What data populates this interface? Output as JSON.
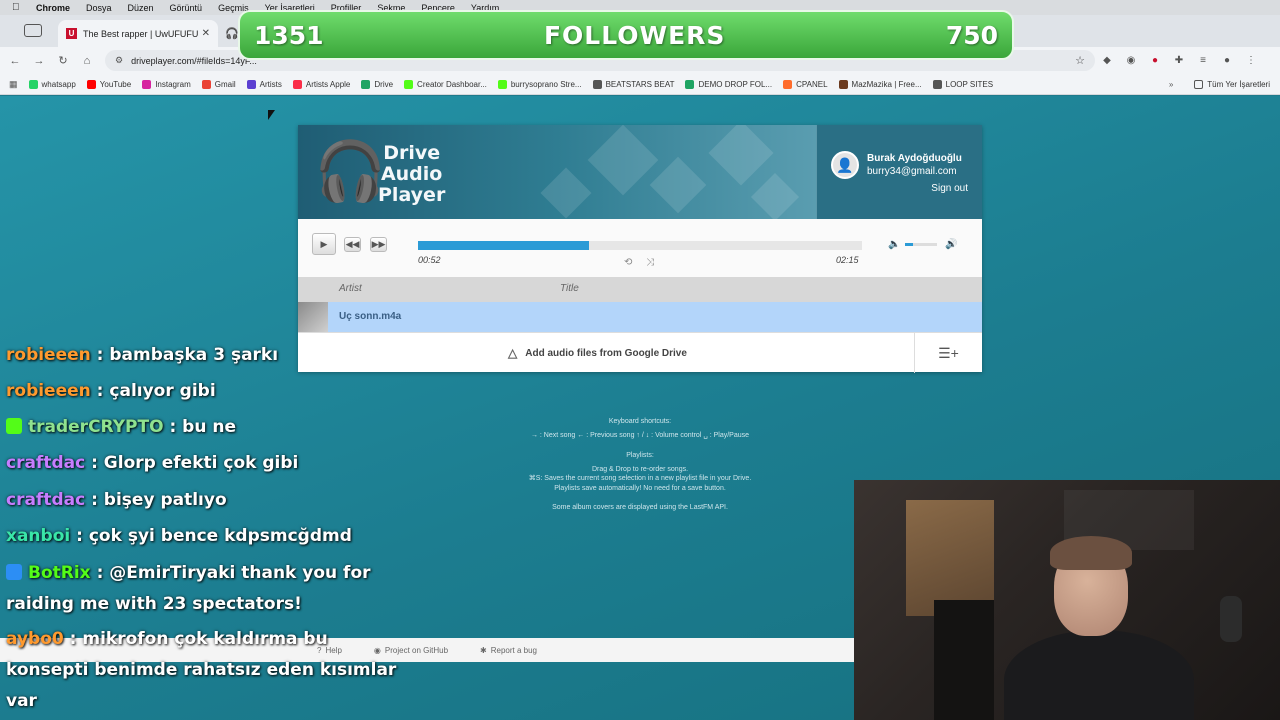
{
  "menubar": {
    "apple": "",
    "items": [
      "Chrome",
      "Dosya",
      "Düzen",
      "Görüntü",
      "Geçmiş",
      "Yer İşaretleri",
      "Profiller",
      "Sekme",
      "Pencere",
      "Yardım"
    ]
  },
  "tabs": {
    "active_title": "The Best rapper | UwUFUFU",
    "active_favicon": "U",
    "second_icon": "headphones-icon"
  },
  "toolbar": {
    "url": "driveplayer.com/#fileIds=14yF..."
  },
  "bookmarks": [
    {
      "label": "whatsapp",
      "color": "#25d366"
    },
    {
      "label": "YouTube",
      "color": "#ff0000"
    },
    {
      "label": "Instagram",
      "color": "#d6249f"
    },
    {
      "label": "Gmail",
      "color": "#ea4335"
    },
    {
      "label": "Artists",
      "color": "#5b3fd1"
    },
    {
      "label": "Artists Apple",
      "color": "#fa2d48"
    },
    {
      "label": "Drive",
      "color": "#1fa463"
    },
    {
      "label": "Creator Dashboar...",
      "color": "#53fc18"
    },
    {
      "label": "burrysoprano Stre...",
      "color": "#53fc18"
    },
    {
      "label": "BEATSTARS BEAT",
      "color": "#555555"
    },
    {
      "label": "DEMO DROP FOL...",
      "color": "#1fa463"
    },
    {
      "label": "CPANEL",
      "color": "#ff6c2c"
    },
    {
      "label": "MazMazika | Free...",
      "color": "#6b3a1f"
    },
    {
      "label": "LOOP SITES",
      "color": "#555555"
    }
  ],
  "bookmarks_all": "Tüm Yer İşaretleri",
  "followers": {
    "left": "1351",
    "label": "FOLLOWERS",
    "right": "750"
  },
  "player": {
    "banner_title_1": "Drive",
    "banner_title_2": "Audio",
    "banner_title_3": "Player",
    "user_name": "Burak Aydoğduoğlu",
    "user_email": "burry34@gmail.com",
    "sign_out": "Sign out",
    "time_current": "00:52",
    "time_total": "02:15",
    "progress_fraction": 0.385,
    "volume_fraction": 0.25,
    "col_artist": "Artist",
    "col_title": "Title",
    "track": "Uç sonn.m4a",
    "add_files": "Add audio files from Google Drive"
  },
  "help": {
    "kb_heading": "Keyboard shortcuts:",
    "kb_text": "→ : Next song  ← : Previous song  ↑ / ↓ : Volume control  ␣ : Play/Pause",
    "pl_heading": "Playlists:",
    "pl_line1": "Drag & Drop to re-order songs.",
    "pl_line2": "⌘S: Saves the current song selection in a new playlist file in your Drive.",
    "pl_line3": "Playlists save automatically! No need for a save button.",
    "lastfm": "Some album covers are displayed using the LastFM API."
  },
  "footer": {
    "help": "Help",
    "github": "Project on GitHub",
    "bug": "Report a bug"
  },
  "chat": [
    {
      "user": "robieeen",
      "color": "#ff9a2e",
      "text": ": bambaşka 3 şarkı",
      "badge": ""
    },
    {
      "user": "robieeen",
      "color": "#ff9a2e",
      "text": ": çalıyor gibi",
      "badge": ""
    },
    {
      "user": "traderCRYPTO",
      "color": "#8fe28f",
      "text": ": bu ne",
      "badge": "#53fc18"
    },
    {
      "user": "craftdac",
      "color": "#c77dff",
      "text": ": Glorp efekti çok gibi",
      "badge": ""
    },
    {
      "user": "craftdac",
      "color": "#c77dff",
      "text": ": bişey patlıyo",
      "badge": ""
    },
    {
      "user": "xanboi",
      "color": "#39e6a8",
      "text": ": çok şyi bence kdpsmcğdmd",
      "badge": ""
    },
    {
      "user": "BotRix",
      "color": "#53fc18",
      "text": ": @EmirTiryaki thank you for raiding me with 23 spectators!",
      "badge": "#2c8ef5"
    },
    {
      "user": "aybo0",
      "color": "#ff9a2e",
      "text": ": mikrofon çok kaldırma bu konsepti benimde rahatsız eden kısımlar var",
      "badge": ""
    }
  ]
}
